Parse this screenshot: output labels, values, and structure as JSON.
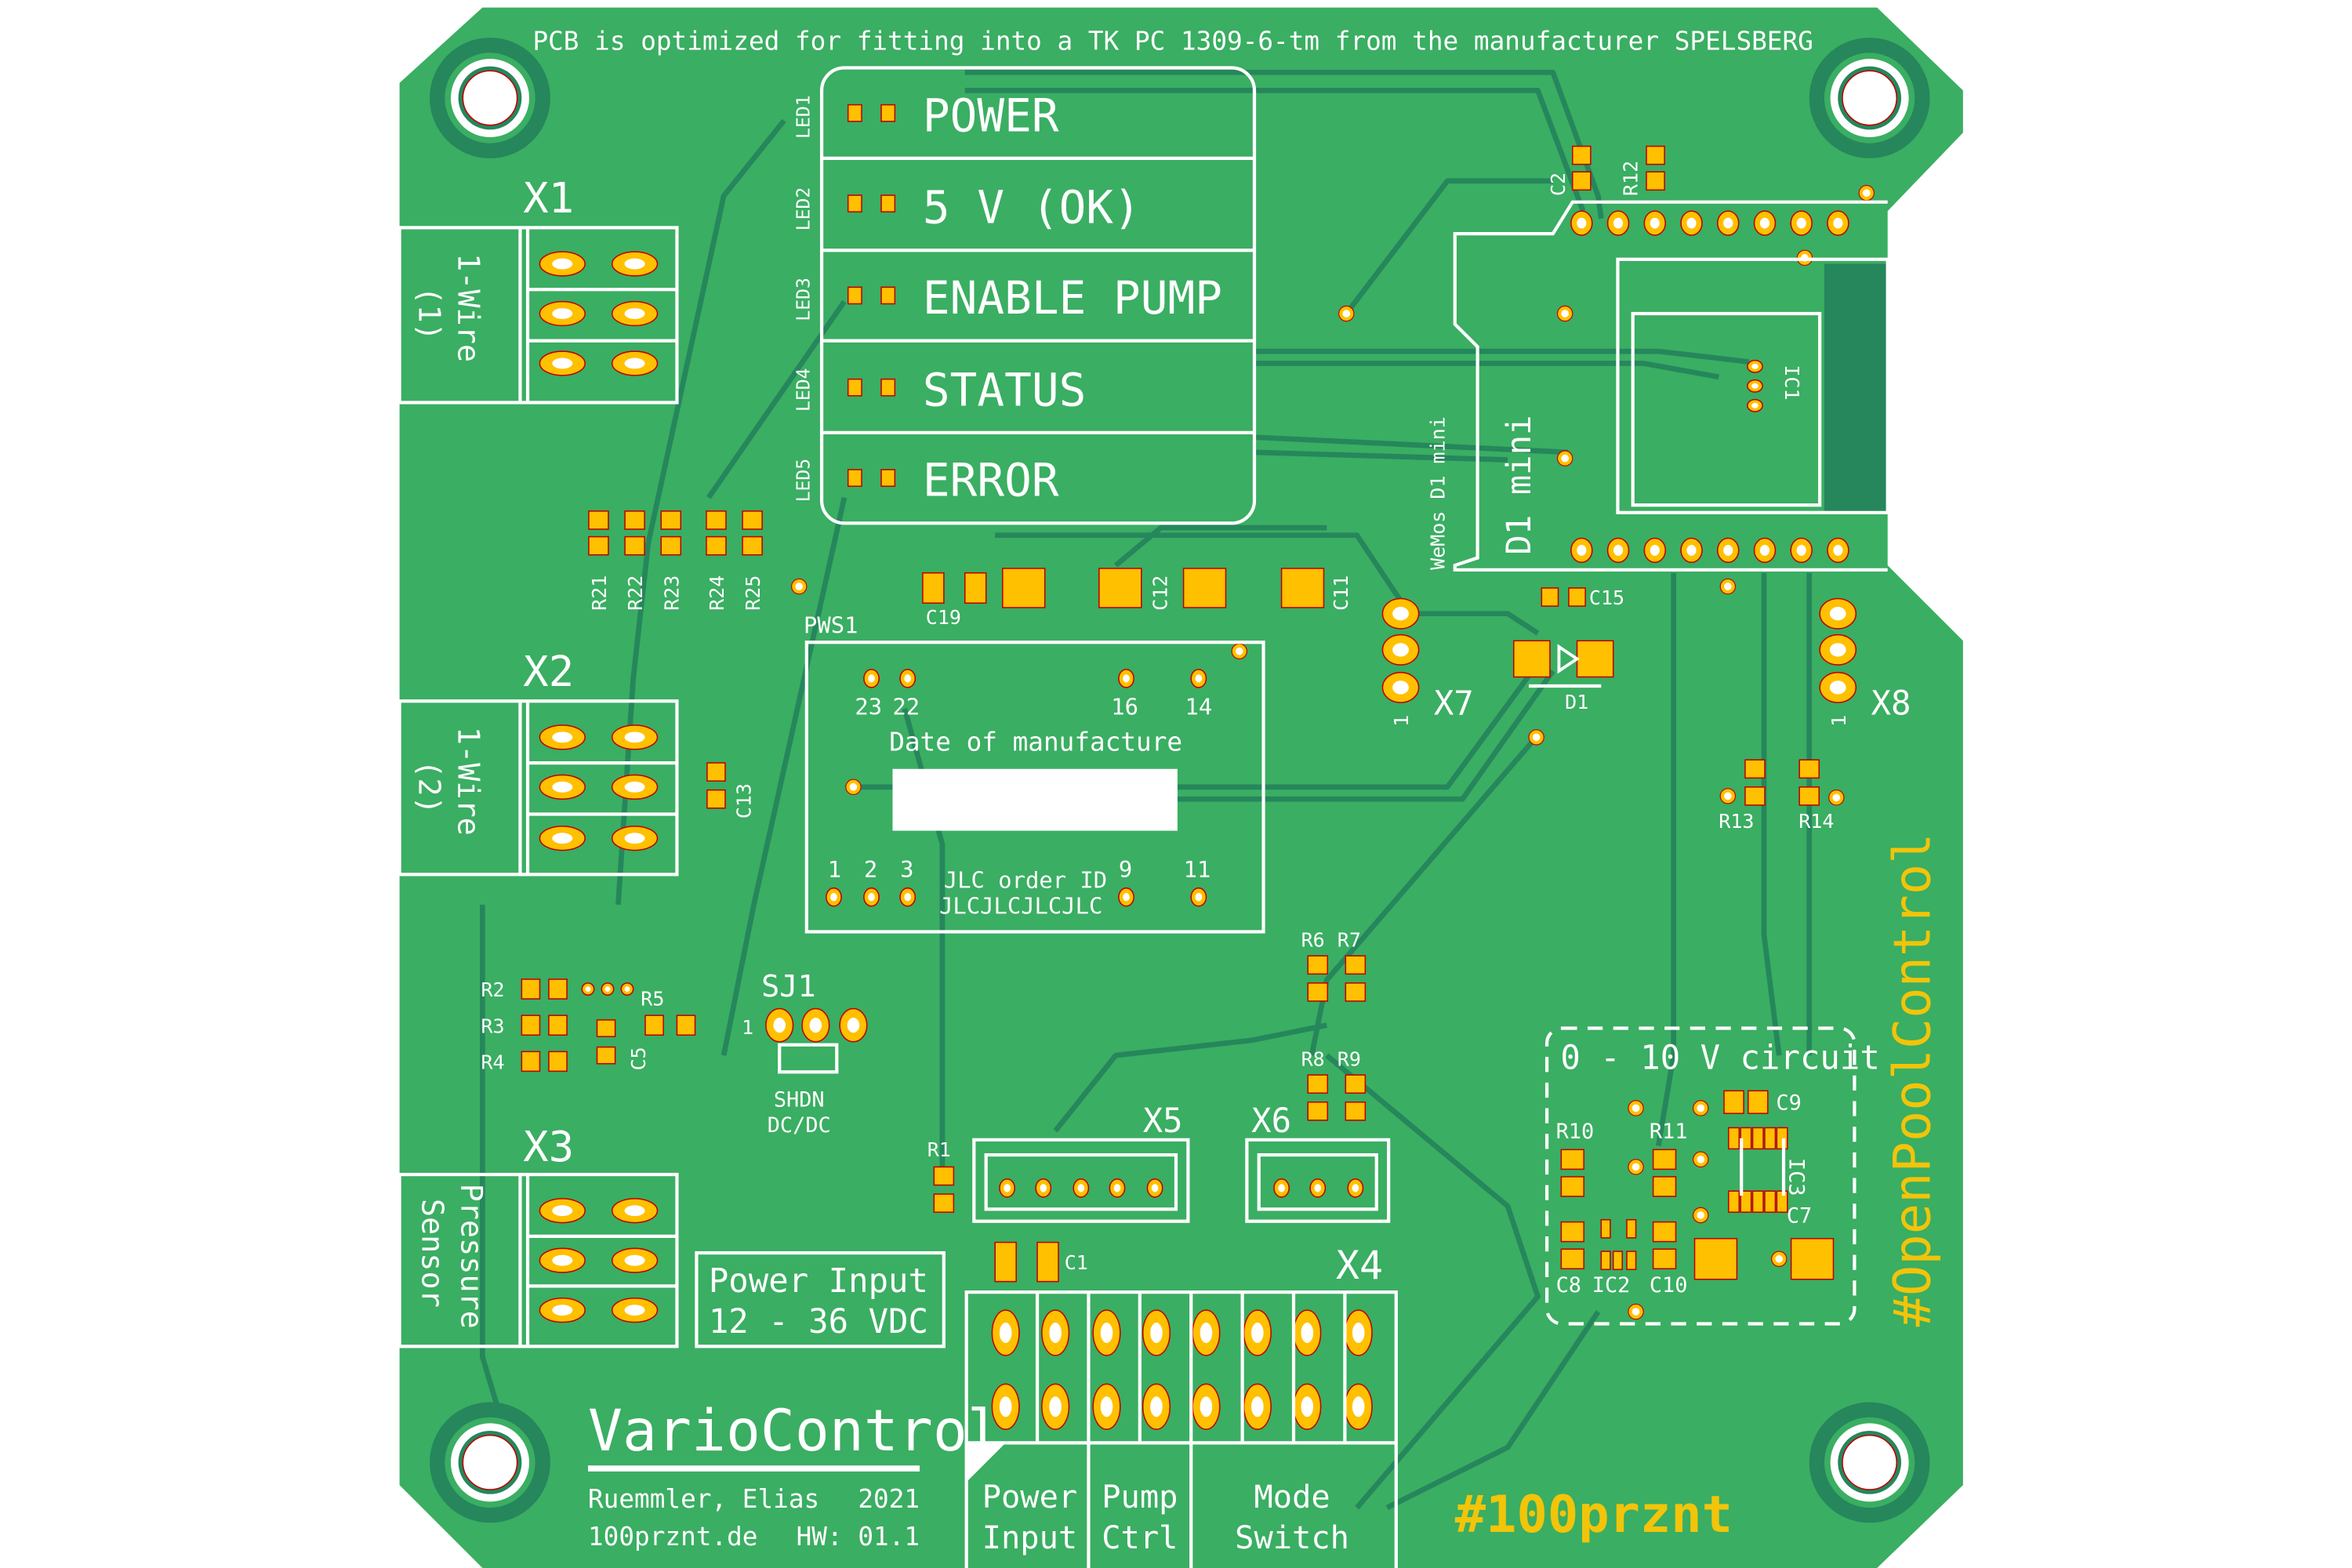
{
  "colors": {
    "board": "#3aae62",
    "trace": "#26865c",
    "pad": "#ffc000",
    "silkscreen": "#ffffff",
    "accent_text": "#f2c40a"
  },
  "header_note": "PCB is optimized for fitting into a TK PC 1309-6-tm from the manufacturer SPELSBERG",
  "led_panel": {
    "rows": [
      {
        "ref": "LED1",
        "label": "POWER"
      },
      {
        "ref": "LED2",
        "label": "5 V (OK)"
      },
      {
        "ref": "LED3",
        "label": "ENABLE PUMP"
      },
      {
        "ref": "LED4",
        "label": "STATUS"
      },
      {
        "ref": "LED5",
        "label": "ERROR"
      }
    ]
  },
  "connectors": {
    "x1": {
      "ref": "X1",
      "label_line1": "1-Wire",
      "label_line2": "(1)"
    },
    "x2": {
      "ref": "X2",
      "label_line1": "1-Wire",
      "label_line2": "(2)"
    },
    "x3": {
      "ref": "X3",
      "label_line1": "Pressure",
      "label_line2": "Sensor"
    },
    "x4": {
      "ref": "X4",
      "groups": [
        {
          "line1": "Power",
          "line2": "Input"
        },
        {
          "line1": "Pump",
          "line2": "Ctrl"
        },
        {
          "line1": "Mode",
          "line2": "Switch"
        }
      ]
    },
    "x5": {
      "ref": "X5"
    },
    "x6": {
      "ref": "X6"
    },
    "x7": {
      "ref": "X7",
      "pin1": "1"
    },
    "x8": {
      "ref": "X8",
      "pin1": "1"
    }
  },
  "resistors": [
    "R21",
    "R22",
    "R23",
    "R24",
    "R25",
    "R2",
    "R3",
    "R4",
    "R5",
    "R1",
    "R6",
    "R7",
    "R8",
    "R9",
    "R12",
    "R13",
    "R14"
  ],
  "capacitors": [
    "C2",
    "C19",
    "C12",
    "C11",
    "C15",
    "C13",
    "C5",
    "C1"
  ],
  "diode": "D1",
  "module": {
    "silk_small": "WeMos D1 mini",
    "silk_large": "D1 mini",
    "ic": "IC1"
  },
  "pws1": {
    "ref": "PWS1",
    "top_pins": [
      "23",
      "22",
      "16",
      "14"
    ],
    "bottom_pins": [
      "1",
      "2",
      "3",
      "9",
      "11"
    ],
    "date_label": "Date of manufacture",
    "order_label": "JLC order ID",
    "order_value": "JLCJLCJLCJLC"
  },
  "jumper": {
    "ref": "SJ1",
    "pin1": "1",
    "label_line1": "SHDN",
    "label_line2": "DC/DC"
  },
  "power_input": {
    "line1": "Power Input",
    "line2": "12 - 36 VDC"
  },
  "analog_circuit": {
    "title": "0 - 10 V circuit",
    "refs": [
      "R10",
      "R11",
      "C9",
      "IC3",
      "C7",
      "C8",
      "IC2",
      "C10"
    ]
  },
  "branding": {
    "product": "VarioControl",
    "author": "Ruemmler, Elias",
    "year": "2021",
    "website": "100prznt.de",
    "hw_version": "HW: 01.1",
    "hashtag1": "#100prznt",
    "hashtag2": "#OpenPoolControl"
  }
}
